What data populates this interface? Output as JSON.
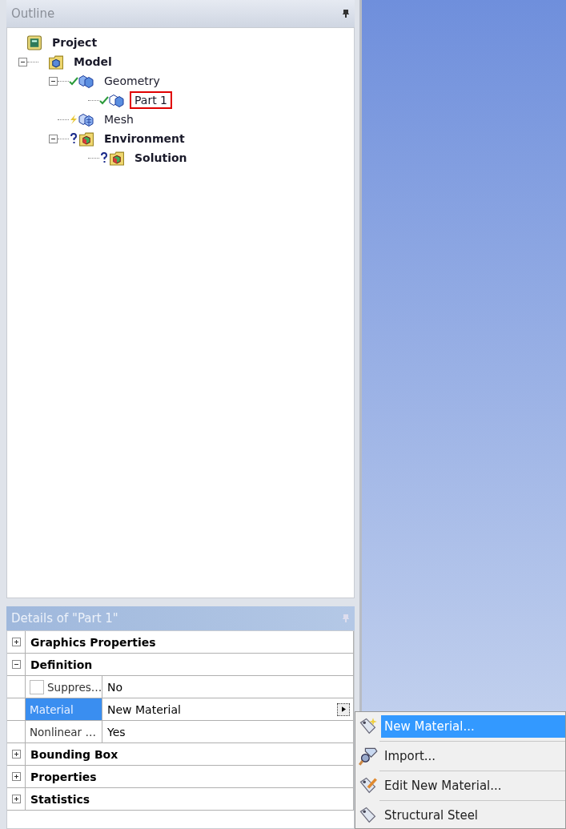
{
  "outline": {
    "title": "Outline",
    "tree": {
      "label": "Project",
      "kind": "project",
      "selected": false,
      "children": [
        {
          "label": "Model",
          "kind": "model",
          "selected": false,
          "expanded": true,
          "children": [
            {
              "label": "Geometry",
              "kind": "geometry",
              "solved": true,
              "selected": false,
              "expanded": true,
              "children": [
                {
                  "label": "Part 1",
                  "kind": "part",
                  "solved": true,
                  "selected": true
                }
              ]
            },
            {
              "label": "Mesh",
              "kind": "mesh",
              "stale": true,
              "selected": false
            },
            {
              "label": "Environment",
              "kind": "environment",
              "unknown": true,
              "selected": false,
              "expanded": true,
              "children": [
                {
                  "label": "Solution",
                  "kind": "solution",
                  "unknown": true,
                  "selected": false
                }
              ]
            }
          ]
        }
      ]
    }
  },
  "details": {
    "title": "Details of \"Part 1\"",
    "rows": [
      {
        "kind": "group",
        "label": "Graphics Properties",
        "expanded": false
      },
      {
        "kind": "group",
        "label": "Definition",
        "expanded": true
      },
      {
        "kind": "check",
        "label": "Suppres…",
        "value": "No",
        "checked": false,
        "selected": false
      },
      {
        "kind": "choice",
        "label": "Material",
        "value": "New Material",
        "selected": true
      },
      {
        "kind": "property",
        "label": "Nonlinear …",
        "value": "Yes",
        "selected": false
      },
      {
        "kind": "group",
        "label": "Bounding Box",
        "expanded": false
      },
      {
        "kind": "group",
        "label": "Properties",
        "expanded": false
      },
      {
        "kind": "group",
        "label": "Statistics",
        "expanded": false
      }
    ]
  },
  "menu": {
    "items": [
      {
        "label": "New Material...",
        "kind": "new",
        "selected": true
      },
      {
        "label": "Import...",
        "kind": "import",
        "selected": false
      },
      {
        "label": "Edit New Material...",
        "kind": "edit",
        "selected": false
      },
      {
        "label": "Structural Steel",
        "kind": "material",
        "selected": false
      }
    ]
  }
}
